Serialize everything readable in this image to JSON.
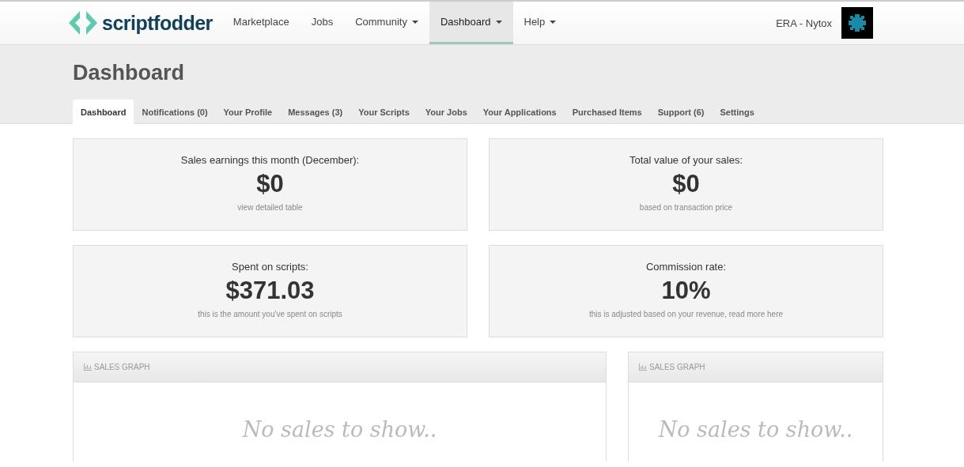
{
  "navbar": {
    "logo": "scriptfodder",
    "items": [
      {
        "label": "Marketplace",
        "dropdown": false,
        "selected": false
      },
      {
        "label": "Jobs",
        "dropdown": false,
        "selected": false
      },
      {
        "label": "Community",
        "dropdown": true,
        "selected": false
      },
      {
        "label": "Dashboard",
        "dropdown": true,
        "selected": true
      },
      {
        "label": "Help",
        "dropdown": true,
        "selected": false
      }
    ],
    "user": "ERA - Nytox"
  },
  "header": {
    "title": "Dashboard",
    "tabs": [
      {
        "label": "Dashboard",
        "selected": true
      },
      {
        "label": "Notifications (0)",
        "selected": false
      },
      {
        "label": "Your Profile",
        "selected": false
      },
      {
        "label": "Messages (3)",
        "selected": false
      },
      {
        "label": "Your Scripts",
        "selected": false
      },
      {
        "label": "Your Jobs",
        "selected": false
      },
      {
        "label": "Your Applications",
        "selected": false
      },
      {
        "label": "Purchased Items",
        "selected": false
      },
      {
        "label": "Support (6)",
        "selected": false
      },
      {
        "label": "Settings",
        "selected": false
      }
    ]
  },
  "stats": [
    {
      "label": "Sales earnings this month (December):",
      "value": "$0",
      "note": "view detailed table"
    },
    {
      "label": "Total value of your sales:",
      "value": "$0",
      "note": "based on transaction price"
    },
    {
      "label": "Spent on scripts:",
      "value": "$371.03",
      "note": "this is the amount you've spent on scripts"
    },
    {
      "label": "Commission rate:",
      "value": "10%",
      "note": "this is adjusted based on your revenue, read more here"
    }
  ],
  "panels": [
    {
      "title": "SALES GRAPH",
      "empty_text": "No sales to show.."
    },
    {
      "title": "SALES GRAPH",
      "empty_text": "No sales to show.."
    }
  ]
}
